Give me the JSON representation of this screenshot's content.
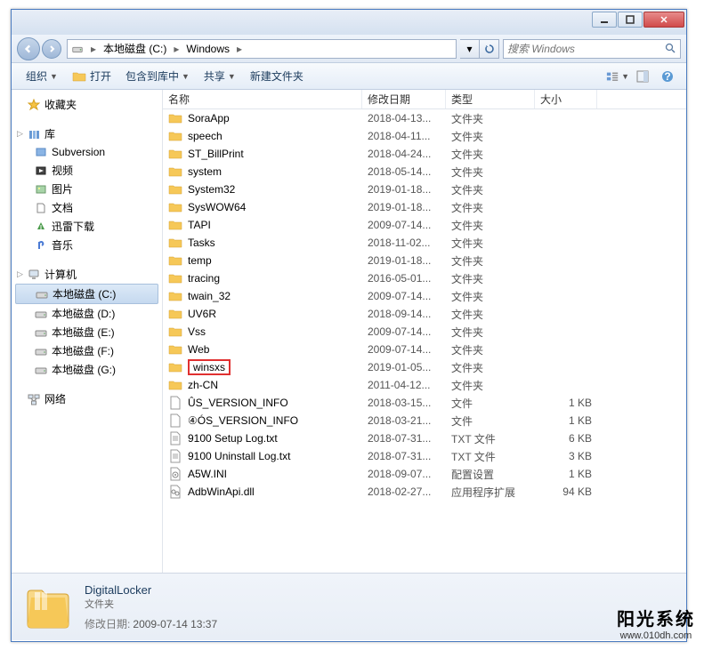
{
  "breadcrumb": {
    "seg1": "本地磁盘 (C:)",
    "seg2": "Windows"
  },
  "search": {
    "placeholder": "搜索 Windows"
  },
  "toolbar": {
    "organize": "组织",
    "open": "打开",
    "include": "包含到库中",
    "share": "共享",
    "newfolder": "新建文件夹"
  },
  "nav": {
    "favorites": "收藏夹",
    "libraries": "库",
    "lib_items": [
      "Subversion",
      "视频",
      "图片",
      "文档",
      "迅雷下载",
      "音乐"
    ],
    "computer": "计算机",
    "drives": [
      "本地磁盘 (C:)",
      "本地磁盘 (D:)",
      "本地磁盘 (E:)",
      "本地磁盘 (F:)",
      "本地磁盘 (G:)"
    ],
    "network": "网络"
  },
  "columns": {
    "name": "名称",
    "date": "修改日期",
    "type": "类型",
    "size": "大小"
  },
  "files": [
    {
      "n": "SoraApp",
      "d": "2018-04-13...",
      "t": "文件夹",
      "s": "",
      "k": "folder"
    },
    {
      "n": "speech",
      "d": "2018-04-11...",
      "t": "文件夹",
      "s": "",
      "k": "folder"
    },
    {
      "n": "ST_BillPrint",
      "d": "2018-04-24...",
      "t": "文件夹",
      "s": "",
      "k": "folder"
    },
    {
      "n": "system",
      "d": "2018-05-14...",
      "t": "文件夹",
      "s": "",
      "k": "folder"
    },
    {
      "n": "System32",
      "d": "2019-01-18...",
      "t": "文件夹",
      "s": "",
      "k": "folder"
    },
    {
      "n": "SysWOW64",
      "d": "2019-01-18...",
      "t": "文件夹",
      "s": "",
      "k": "folder"
    },
    {
      "n": "TAPI",
      "d": "2009-07-14...",
      "t": "文件夹",
      "s": "",
      "k": "folder"
    },
    {
      "n": "Tasks",
      "d": "2018-11-02...",
      "t": "文件夹",
      "s": "",
      "k": "folder"
    },
    {
      "n": "temp",
      "d": "2019-01-18...",
      "t": "文件夹",
      "s": "",
      "k": "folder"
    },
    {
      "n": "tracing",
      "d": "2016-05-01...",
      "t": "文件夹",
      "s": "",
      "k": "folder"
    },
    {
      "n": "twain_32",
      "d": "2009-07-14...",
      "t": "文件夹",
      "s": "",
      "k": "folder"
    },
    {
      "n": "UV6R",
      "d": "2018-09-14...",
      "t": "文件夹",
      "s": "",
      "k": "folder"
    },
    {
      "n": "Vss",
      "d": "2009-07-14...",
      "t": "文件夹",
      "s": "",
      "k": "folder"
    },
    {
      "n": "Web",
      "d": "2009-07-14...",
      "t": "文件夹",
      "s": "",
      "k": "folder"
    },
    {
      "n": "winsxs",
      "d": "2019-01-05...",
      "t": "文件夹",
      "s": "",
      "k": "folder",
      "hl": true
    },
    {
      "n": "zh-CN",
      "d": "2011-04-12...",
      "t": "文件夹",
      "s": "",
      "k": "folder"
    },
    {
      "n": "ÛS_VERSION_INFO",
      "d": "2018-03-15...",
      "t": "文件",
      "s": "1 KB",
      "k": "file"
    },
    {
      "n": "④ÓS_VERSION_INFO",
      "d": "2018-03-21...",
      "t": "文件",
      "s": "1 KB",
      "k": "file"
    },
    {
      "n": "9100 Setup Log.txt",
      "d": "2018-07-31...",
      "t": "TXT 文件",
      "s": "6 KB",
      "k": "txt"
    },
    {
      "n": "9100 Uninstall Log.txt",
      "d": "2018-07-31...",
      "t": "TXT 文件",
      "s": "3 KB",
      "k": "txt"
    },
    {
      "n": "A5W.INI",
      "d": "2018-09-07...",
      "t": "配置设置",
      "s": "1 KB",
      "k": "ini"
    },
    {
      "n": "AdbWinApi.dll",
      "d": "2018-02-27...",
      "t": "应用程序扩展",
      "s": "94 KB",
      "k": "dll"
    }
  ],
  "details": {
    "name": "DigitalLocker",
    "type": "文件夹",
    "date_label": "修改日期:",
    "date_value": "2009-07-14 13:37"
  },
  "watermark": {
    "line1": "阳光系统",
    "line2": "www.010dh.com"
  }
}
